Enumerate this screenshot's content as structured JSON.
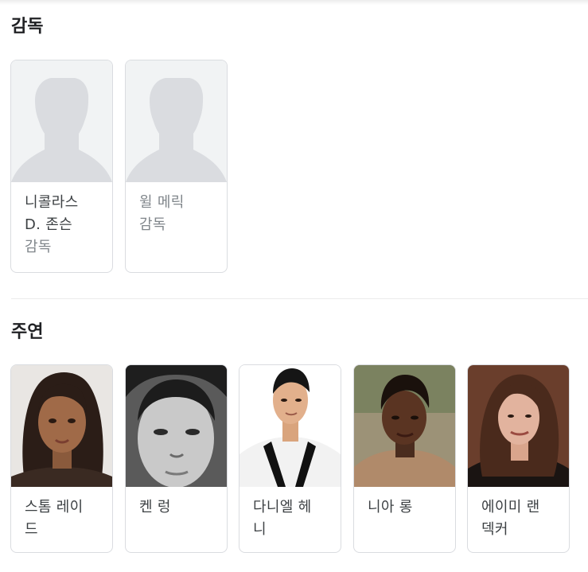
{
  "directors": {
    "title": "감독",
    "items": [
      {
        "name_line1": "니콜라스",
        "name_line2": "D. 존슨",
        "role": "감독",
        "photo_icon": "person-placeholder-icon"
      },
      {
        "name": "윌 메릭",
        "role": "감독",
        "photo_icon": "person-placeholder-icon"
      }
    ]
  },
  "cast": {
    "title": "주연",
    "items": [
      {
        "name_line1": "스톰 레이",
        "name_line2": "드"
      },
      {
        "name_line1": "켄 렁",
        "name_line2": ""
      },
      {
        "name_line1": "다니엘 헤",
        "name_line2": "니"
      },
      {
        "name_line1": "니아 롱",
        "name_line2": ""
      },
      {
        "name_line1": "에이미 랜",
        "name_line2": "덱커"
      }
    ]
  },
  "colors": {
    "placeholder_bg": "#f1f3f4",
    "placeholder_figure": "#dadce0",
    "card_border": "#dadce0",
    "role_text": "#80868b"
  }
}
